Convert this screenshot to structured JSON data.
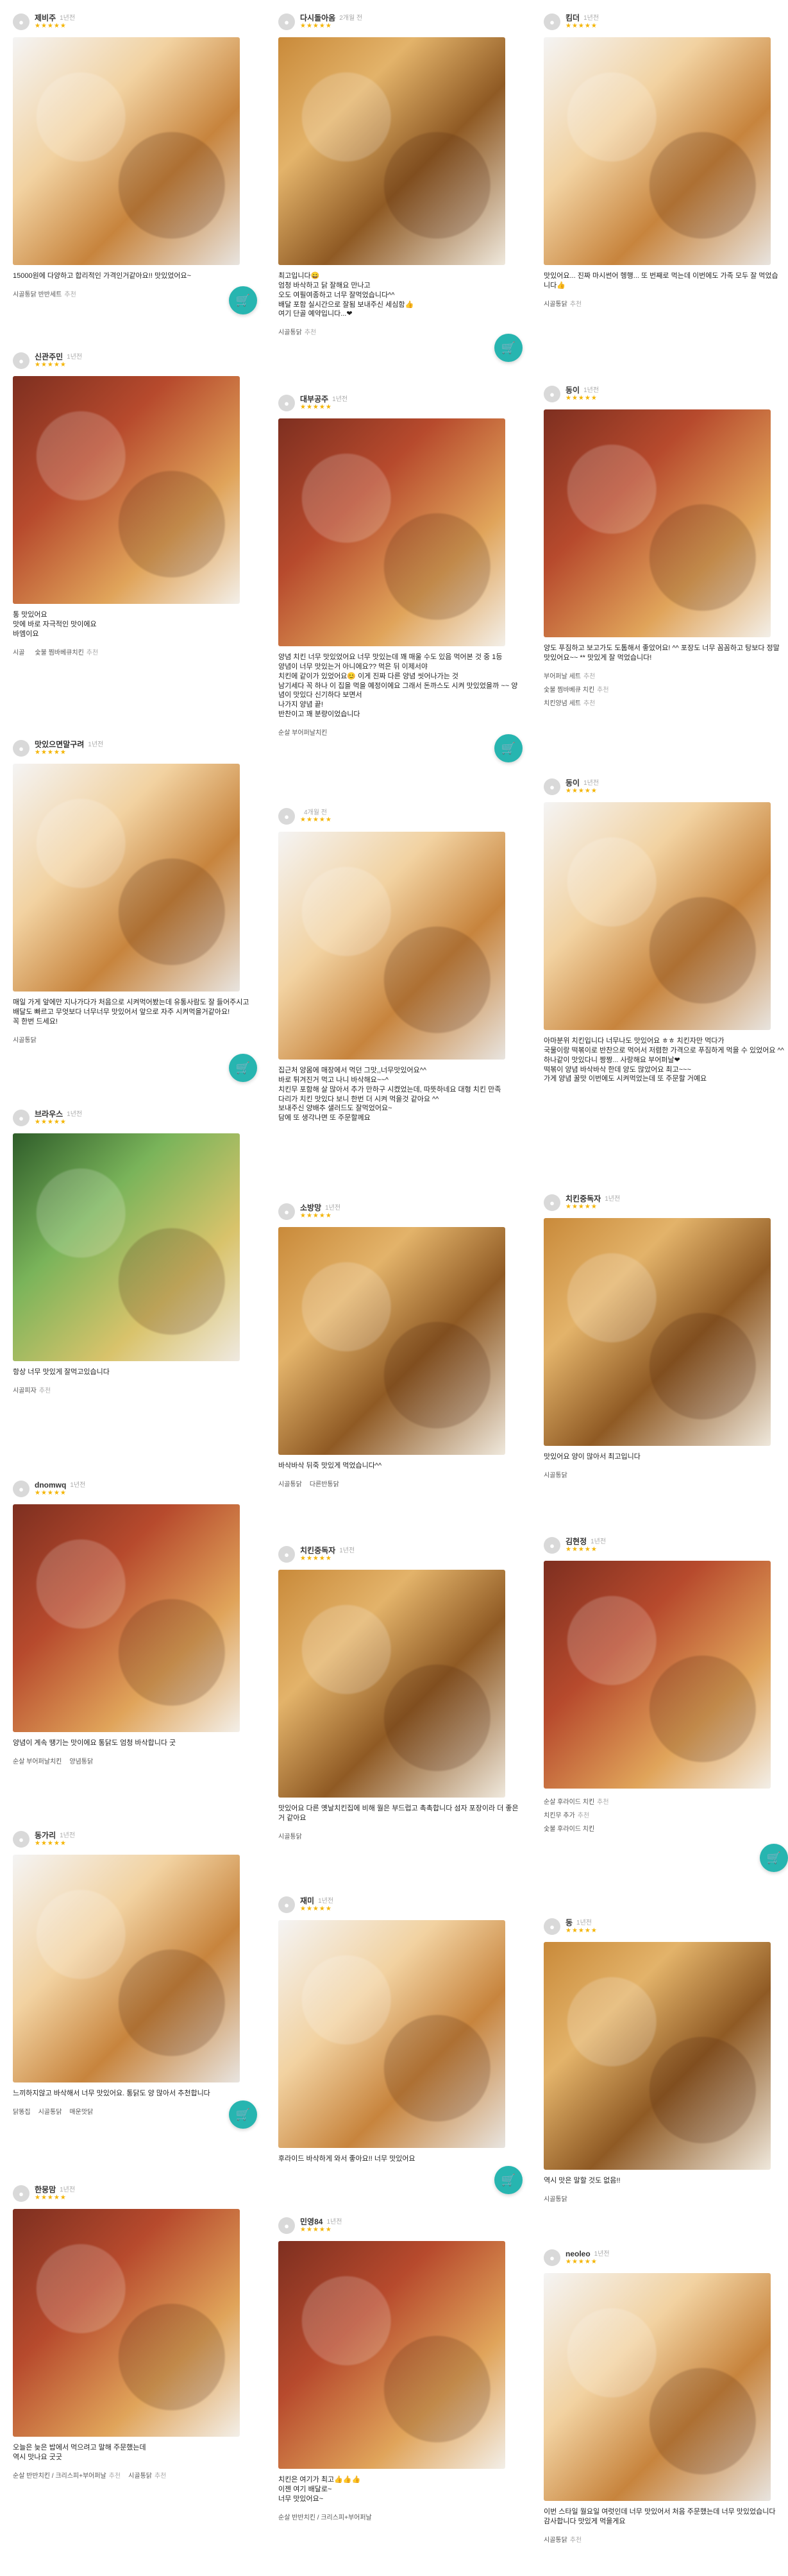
{
  "cards": [
    {
      "author": "제비주",
      "date": "1년전",
      "text": "15000원에 다양하고 합리적인 가격인거같아요!! 맛있었어요~",
      "tags": [
        {
          "name": "시골통닭 반반세트",
          "reco": "추천"
        }
      ]
    },
    {
      "author": "다시돌아옴",
      "date": "2개월 전",
      "text": "최고입니다😄\n엄청 바삭하고 닭 잘해요 만나고\n오도 여필여종하고 너무 잘먹었습니다^^\n배달 포함 실시간으로 잘됨 보내주신 세심함👍\n여기 단골 예약입니다...❤",
      "tags": [
        {
          "name": "시골통닭",
          "reco": "추천"
        }
      ]
    },
    {
      "author": "킴더",
      "date": "1년전",
      "text": "맛있어요... 진짜 마시썬어 헹행... 또 번째로 먹는데 이번에도 가족 모두 잘 먹었습니다👍",
      "tags": [
        {
          "name": "시골통닭",
          "reco": "추천"
        }
      ]
    },
    {
      "author": "신관주민",
      "date": "1년전",
      "text": "통 맛있어요\n맛에 바로 자극적인 맛이에요\n바엠이요",
      "tags": [
        {
          "name": "시골",
          "reco": ""
        },
        {
          "name": "숯불 찜바베큐치킨",
          "reco": "추천"
        }
      ]
    },
    {
      "author": "대부공주",
      "date": "1년전",
      "text": "양념 치킨 너무 맛있었어요 너무 맛있는데 꽤 매울 수도 있음 먹어본 것 중 1등\n양념이 너무 맛있는거 아니에요?? 먹은 뒤 이제서야\n치킨에 같이가 있었어요😊 이게 진짜 다른 양념 씻어나가는 것\n남기세다 꼭 하나 이 집을 먹을 예정이에요 그래서 돈까스도 시켜 맛있었을까 ~~ 양념이 맛있다 신기하다 보면서\n나가지 양념 끝!\n반찬이고 꽤 분량이었습니다",
      "tags": [
        {
          "name": "순살 부어퍼날치킨",
          "reco": ""
        }
      ]
    },
    {
      "author": "동이",
      "date": "1년전",
      "text": "양도 푸짐하고 보고가도 도톰해서 좋았어요! ^^ 포장도 너무 꼼꼼하고 탕보다 정말 맛있어요~~ ** 맛있게 잘 먹었습니다!",
      "tags": [
        {
          "name": "부어퍼날 세트",
          "reco": "추천"
        },
        {
          "name": "숯불 찜바베큐 치킨",
          "reco": "추천"
        },
        {
          "name": "치킨양념 세트",
          "reco": "추천"
        }
      ]
    },
    {
      "author": "맛있으면말구려",
      "date": "1년전",
      "text": "매일 가게 앞에만 지나가다가 처음으로 시켜먹어봤는데 유통사람도 잘 들어주시고 배달도 빠르고 무엇보다 너무너무 맛있어서 앞으로 자주 시켜먹을거같아요!\n꼭 한번 드세요!",
      "tags": [
        {
          "name": "시골통닭",
          "reco": ""
        }
      ]
    },
    {
      "author": "",
      "date": "4개월 전",
      "text": "집근처 양몸에 매장에서 먹던 그맛,,너무맛있어요^^\n바로 튀겨진거 먹고 나니 바삭해요~~^\n치킨무 포함해 살 많아서 추가 만하구 시켰었는데, 따뜻하네요 대형 치킨 만족\n다리가 치킨 맛있다 보니 한번 더 시켜 먹을것 같아요 ^^\n보내주신 양배추 샐러드도 잘먹었어요~\n담에 또 생각나면 또 주문할께요",
      "tags": []
    },
    {
      "author": "동이",
      "date": "1년전",
      "text": "아마분위 치킨입니다 너무나도 맛있어요 ㅎㅎ 치킨자만 먹다가\n국물이랑 떡볶이로 반찬으로 먹어서 저렴한 가격으로 푸짐하게 먹을 수 있었어요 ^^\n하나같이 맛있다니 짱짱... 사랑해요 부어퍼날❤\n떡볶이 양념 바삭바삭 한데 양도 많았어요 최고~~~\n가게 양념 꿀맛 이번에도 시켜먹었는데 또 주문할 거예요",
      "tags": []
    },
    {
      "author": "브라우스",
      "date": "1년전",
      "text": "항상 너무 맛있게 잘먹고있습니다",
      "tags": [
        {
          "name": "시골피자",
          "reco": "추천"
        }
      ]
    },
    {
      "author": "소방망",
      "date": "1년전",
      "text": "바삭바삭 뒤죽 맛있게 먹었습니다^^",
      "tags": [
        {
          "name": "시골통닭",
          "reco": ""
        },
        {
          "name": "다른반통닭",
          "reco": ""
        }
      ]
    },
    {
      "author": "치킨중독자",
      "date": "1년전",
      "text": "맛있어요 양이 많아서 최고입니다",
      "tags": [
        {
          "name": "시골통닭",
          "reco": ""
        }
      ]
    },
    {
      "author": "dnomwq",
      "date": "1년전",
      "text": "양념이 계속 땡기는 맛이에요 통닭도 엄청 바삭합니다 굿",
      "tags": [
        {
          "name": "순살 부어퍼날치킨",
          "reco": ""
        },
        {
          "name": "양념통닭",
          "reco": ""
        }
      ]
    },
    {
      "author": "치킨중독자",
      "date": "1년전",
      "text": "맛있어요 다른 옛날치킨집에 비해 월은 부드럽고 촉촉합니다 섬자 포장이라 더 좋은거 같아요",
      "tags": [
        {
          "name": "시골통닭",
          "reco": ""
        }
      ]
    },
    {
      "author": "김현정",
      "date": "1년전",
      "text": "",
      "tags": [
        {
          "name": "순살 후라이드 치킨",
          "reco": "추천"
        },
        {
          "name": "치킨무 추가",
          "reco": "추천"
        },
        {
          "name": "숯불 후라이드 치킨",
          "reco": ""
        }
      ]
    },
    {
      "author": "동가리",
      "date": "1년전",
      "text": "느끼하지않고 바삭해서 너무 맛있어요. 통닭도 양 많아서 추천합니다",
      "tags": [
        {
          "name": "닭똥집",
          "reco": ""
        },
        {
          "name": "시골통닭",
          "reco": ""
        },
        {
          "name": "매운맛닭",
          "reco": ""
        }
      ]
    },
    {
      "author": "재미",
      "date": "1년전",
      "text": "후라이드 바삭하게 와서 좋아요!! 너무 맛있어요",
      "tags": []
    },
    {
      "author": "동",
      "date": "1년전",
      "text": "역시 맛은 말할 것도 없음!!",
      "tags": [
        {
          "name": "시골통닭",
          "reco": ""
        }
      ]
    },
    {
      "author": "한뭉맘",
      "date": "1년전",
      "text": "오늘은 늦은 밥에서 먹으려고 말해 주문했는데\n역시 맛나요 굿굿",
      "tags": [
        {
          "name": "순살 반반치킨 / 크리스피+부어퍼날",
          "reco": "추천"
        },
        {
          "name": "시골통닭",
          "reco": "추천"
        }
      ]
    },
    {
      "author": "민영84",
      "date": "1년전",
      "text": "치킨은 여기가 최고👍👍👍\n이젠 여기 배달로~\n너무 맛있어요~",
      "tags": [
        {
          "name": "순살 반반치킨 / 크리스피+부어퍼날",
          "reco": ""
        }
      ]
    },
    {
      "author": "neoleo",
      "date": "1년전",
      "text": "이번 스타일 월요일 여럿인데 너무 맛있어서 처음 주문했는데 너무 맛있었습니다\n감사합니다 맛있게 먹을게요",
      "tags": [
        {
          "name": "시골통닭",
          "reco": "추천"
        }
      ]
    }
  ],
  "icons": {
    "cart": "cart-icon"
  },
  "colors": {
    "accent": "#27b5b0",
    "star": "#f4b400"
  }
}
